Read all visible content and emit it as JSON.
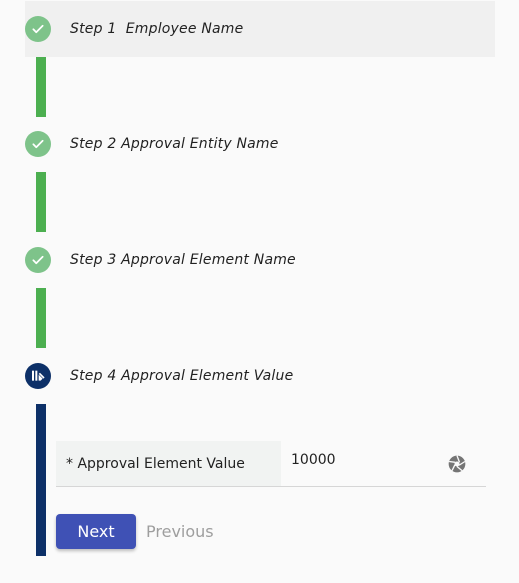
{
  "steps": [
    {
      "label": "Step 1  Employee Name",
      "status": "completed",
      "icon": "check-icon"
    },
    {
      "label": "Step 2 Approval Entity Name",
      "status": "completed",
      "icon": "check-icon"
    },
    {
      "label": "Step 3 Approval Element Name",
      "status": "completed",
      "icon": "check-icon"
    },
    {
      "label": "Step 4 Approval Element Value",
      "status": "current",
      "icon": "edit-icon"
    }
  ],
  "form": {
    "field_label": "* Approval Element Value",
    "field_value": "10000",
    "suffix_icon": "aperture-icon"
  },
  "buttons": {
    "next": "Next",
    "previous": "Previous"
  },
  "colors": {
    "completed": "#7ec38a",
    "connector_done": "#4caf50",
    "current": "#0d3068",
    "primary_button": "#3f51b5",
    "disabled_text": "#9e9e9e"
  }
}
